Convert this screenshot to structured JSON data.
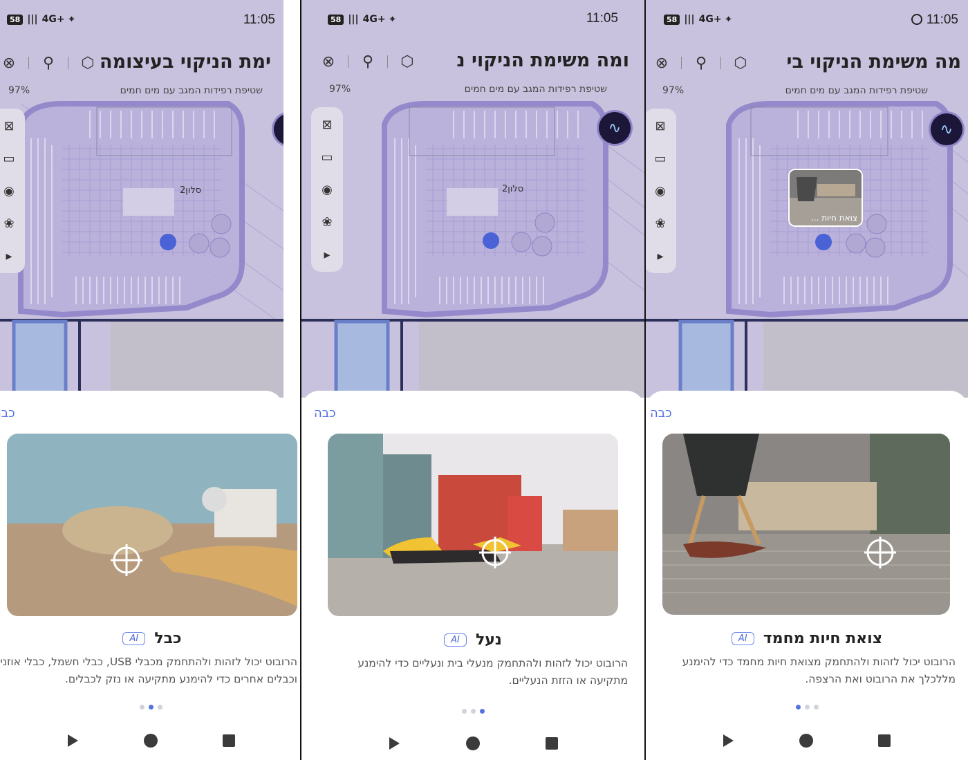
{
  "status": {
    "battery_level": "58",
    "network": "4G+",
    "time": "11:05"
  },
  "header": {
    "title": "משימת הניקוי בעיצומה",
    "title_variants": [
      "משימת הניקוי בעיצומה",
      "ומה   משימת הניקוי נ",
      "מה   משימת הניקוי בי"
    ]
  },
  "mission": {
    "battery": "97%",
    "description": "שטיפת רפידות המגב עם מים חמים"
  },
  "map": {
    "room_label": "סלון2"
  },
  "sheet": {
    "close_label": "כבה",
    "ai_badge": "AI"
  },
  "panels": [
    {
      "title": "ימת הניקוי בעיצומה",
      "name": "כבל",
      "description": "הרובוט יכול לזהות ולהתחמק מכבלי USB, כבלי חשמל, כבלי אוזניות וכבלים אחרים כדי להימנע מתקיעה או נזק לכבלים.",
      "active_dot": 1,
      "thumb_caption": ""
    },
    {
      "title": "ומה   משימת הניקוי נ",
      "name": "נעל",
      "description": "הרובוט יכול לזהות ולהתחמק מנעלי בית ונעליים כדי להימנע מתקיעה או הזזת הנעליים.",
      "active_dot": 2,
      "thumb_caption": ""
    },
    {
      "title": "מה   משימת הניקוי בי",
      "name": "צואת חיות מחמד",
      "description": "הרובוט יכול לזהות ולהתחמק מצואת חיות מחמד כדי להימנע מללכלך את הרובוט ואת הרצפה.",
      "active_dot": 0,
      "thumb_caption": "צואת חיות ..."
    }
  ],
  "colors": {
    "accent": "#5573e0",
    "map_overlay": "#c7c1d6",
    "robot_fab": "#1c1638"
  }
}
